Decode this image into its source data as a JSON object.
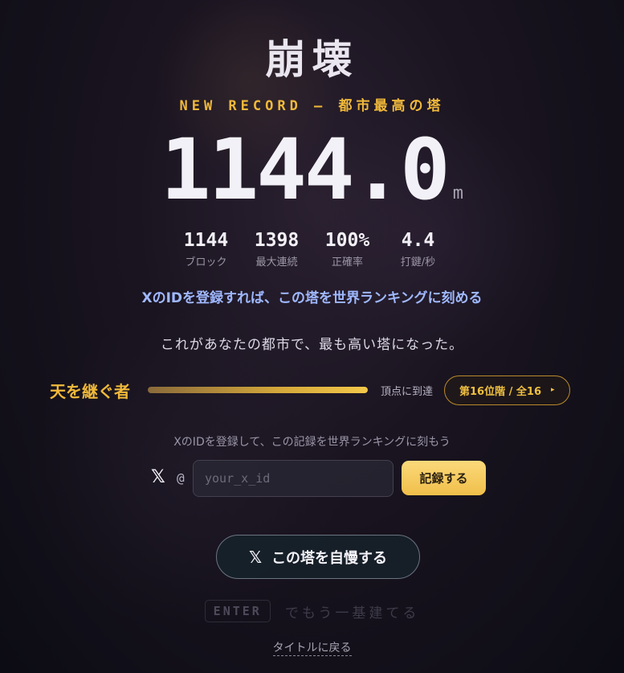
{
  "title": "崩壊",
  "record_label": "NEW RECORD — 都市最高の塔",
  "height": {
    "value": "1144.0",
    "unit": "m"
  },
  "stats": [
    {
      "value": "1144",
      "label": "ブロック"
    },
    {
      "value": "1398",
      "label": "最大連続"
    },
    {
      "value": "100%",
      "label": "正確率"
    },
    {
      "value": "4.4",
      "label": "打鍵/秒"
    }
  ],
  "ranking_cta": "XのIDを登録すれば、この塔を世界ランキングに刻める",
  "message": "これがあなたの都市で、最も高い塔になった。",
  "rank": {
    "name": "天を継ぐ者",
    "progress": 1.0,
    "reach_label": "頂点に到達",
    "floor_label": "第16位階 / 全16",
    "arrow": "▸"
  },
  "register": {
    "hint": "XのIDを登録して、この記録を世界ランキングに刻もう",
    "x_symbol": "𝕏",
    "at": "@",
    "placeholder": "your_x_id",
    "save_label": "記録する"
  },
  "share": {
    "x_symbol": "𝕏",
    "label": "この塔を自慢する"
  },
  "retry": {
    "key": "ENTER",
    "label": "でもう一基建てる"
  },
  "back_label": "タイトルに戻る",
  "colors": {
    "accent": "#f0b93a",
    "link": "#9fb8ff"
  }
}
